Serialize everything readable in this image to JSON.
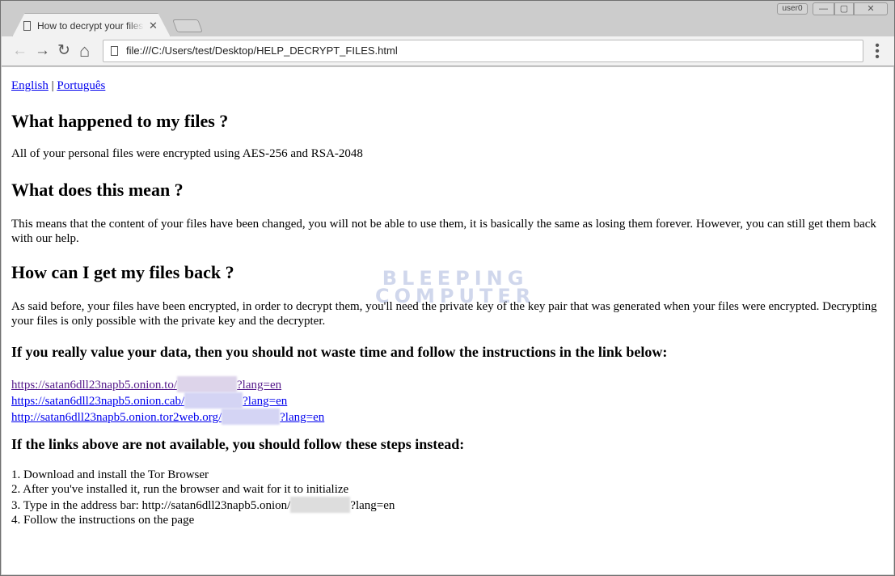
{
  "window": {
    "user_badge": "user0",
    "minimize": "—",
    "maximize": "▢",
    "close": "✕"
  },
  "tab": {
    "title": "How to decrypt your files",
    "close": "✕",
    "icon": "document-icon"
  },
  "toolbar": {
    "back": "←",
    "forward": "→",
    "reload": "↻",
    "home": "⌂",
    "url": "file:///C:/Users/test/Desktop/HELP_DECRYPT_FILES.html",
    "menu": "⋮"
  },
  "page": {
    "lang_links": [
      "English",
      "Português"
    ],
    "lang_sep": " | ",
    "h1": "What happened to my files ?",
    "p1": "All of your personal files were encrypted using AES-256 and RSA-2048",
    "h2": "What does this mean ?",
    "p2": "This means that the content of your files have been changed, you will not be able to use them, it is basically the same as losing them forever. However, you can still get them back with our help.",
    "h3": "How can I get my files back ?",
    "p3": "As said before, your files have been encrypted, in order to decrypt them, you'll need the private key of the key pair that was generated when your files were encrypted. Decrypting your files is only possible with the private key and the decrypter.",
    "h4": "If you really value your data, then you should not waste time and follow the instructions in the link below:",
    "links": [
      {
        "prefix": "https://satan6dll23napb5.onion.to/",
        "suffix": "?lang=en"
      },
      {
        "prefix": "https://satan6dll23napb5.onion.cab/",
        "suffix": "?lang=en"
      },
      {
        "prefix": "http://satan6dll23napb5.onion.tor2web.org/",
        "suffix": "?lang=en"
      }
    ],
    "h5": "If the links above are not available, you should follow these steps instead:",
    "steps": [
      "1. Download and install the Tor Browser",
      "2. After you've installed it, run the browser and wait for it to initialize",
      "3. Type in the address bar: http://satan6dll23napb5.onion/",
      "?lang=en",
      "4. Follow the instructions on the page"
    ],
    "watermark": "BLEEPING COMPUTER"
  }
}
